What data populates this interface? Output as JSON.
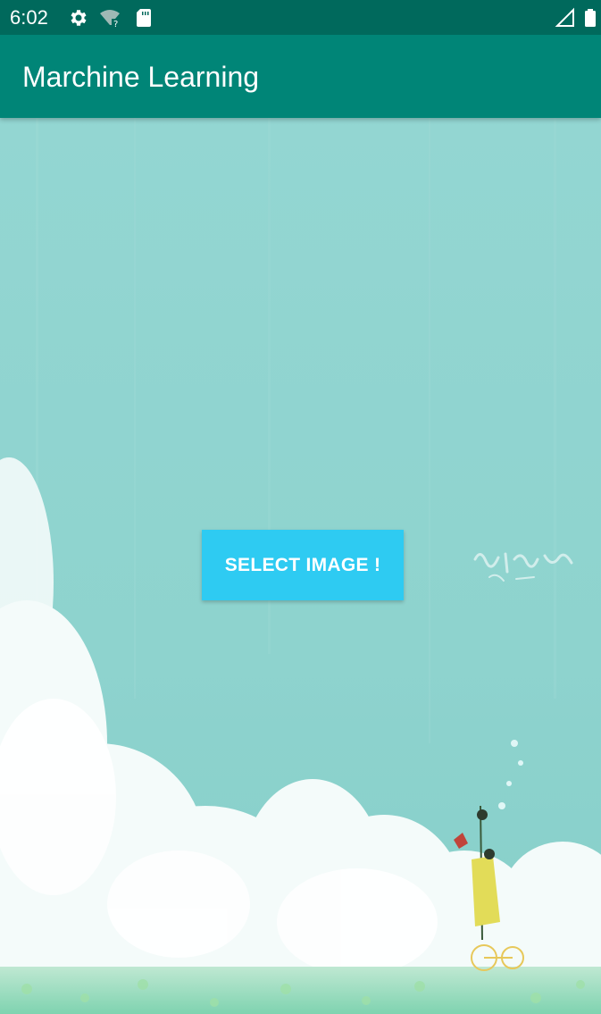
{
  "status_bar": {
    "time": "6:02",
    "icons_left": [
      "gear-icon",
      "wifi-unknown-icon",
      "sd-card-icon"
    ],
    "icons_right": [
      "signal-icon",
      "battery-icon"
    ],
    "color": "#00695c"
  },
  "app_bar": {
    "title": "Marchine Learning",
    "color": "#008577"
  },
  "main": {
    "select_button_label": "SELECT IMAGE !",
    "button_color": "#2ecbf2",
    "background": "sky-clouds-cyclist-illustration"
  }
}
